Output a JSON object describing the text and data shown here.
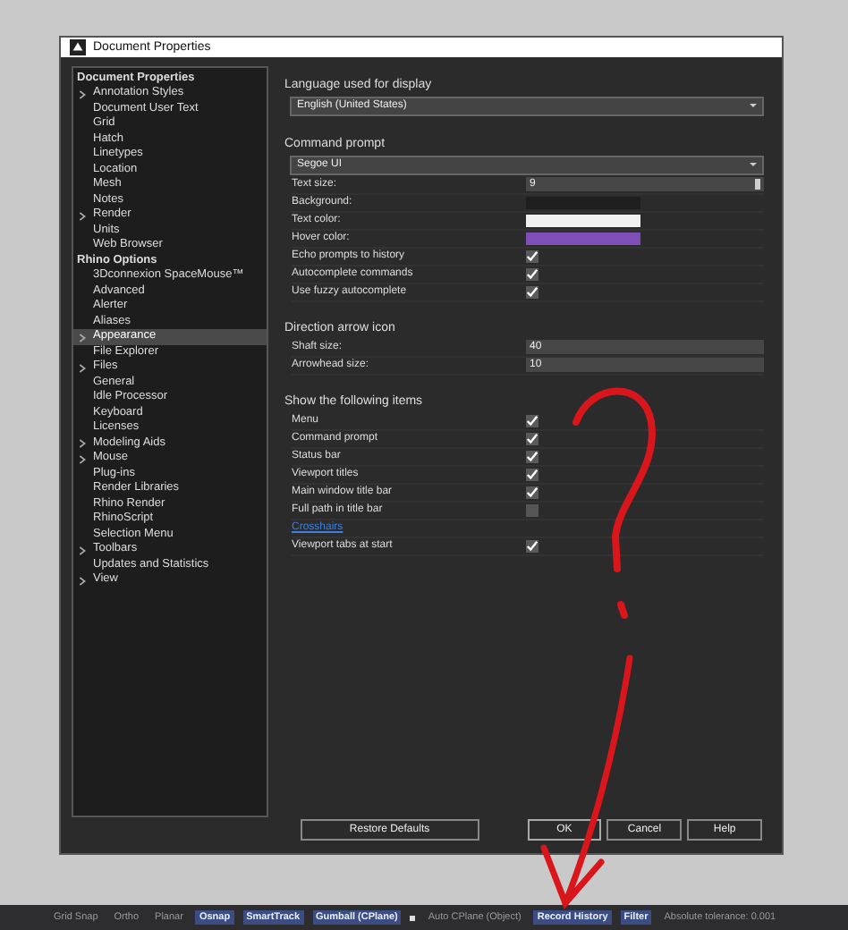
{
  "window": {
    "title": "Document Properties"
  },
  "tree": [
    {
      "label": "Document Properties",
      "selected": false,
      "children": [
        {
          "label": "Annotation Styles",
          "collapsible": true,
          "selected": false
        },
        {
          "label": "Document User Text",
          "collapsible": false,
          "selected": false
        },
        {
          "label": "Grid",
          "collapsible": false,
          "selected": false
        },
        {
          "label": "Hatch",
          "collapsible": false,
          "selected": false
        },
        {
          "label": "Linetypes",
          "collapsible": false,
          "selected": false
        },
        {
          "label": "Location",
          "collapsible": false,
          "selected": false
        },
        {
          "label": "Mesh",
          "collapsible": false,
          "selected": false
        },
        {
          "label": "Notes",
          "collapsible": false,
          "selected": false
        },
        {
          "label": "Render",
          "collapsible": true,
          "selected": false
        },
        {
          "label": "Units",
          "collapsible": false,
          "selected": false
        },
        {
          "label": "Web Browser",
          "collapsible": false,
          "selected": false
        }
      ]
    },
    {
      "label": "Rhino Options",
      "selected": false,
      "children": [
        {
          "label": "3Dconnexion SpaceMouse™",
          "collapsible": false,
          "selected": false
        },
        {
          "label": "Advanced",
          "collapsible": false,
          "selected": false
        },
        {
          "label": "Alerter",
          "collapsible": false,
          "selected": false
        },
        {
          "label": "Aliases",
          "collapsible": false,
          "selected": false
        },
        {
          "label": "Appearance",
          "collapsible": true,
          "selected": true
        },
        {
          "label": "File Explorer",
          "collapsible": false,
          "selected": false
        },
        {
          "label": "Files",
          "collapsible": true,
          "selected": false
        },
        {
          "label": "General",
          "collapsible": false,
          "selected": false
        },
        {
          "label": "Idle Processor",
          "collapsible": false,
          "selected": false
        },
        {
          "label": "Keyboard",
          "collapsible": false,
          "selected": false
        },
        {
          "label": "Licenses",
          "collapsible": false,
          "selected": false
        },
        {
          "label": "Modeling Aids",
          "collapsible": true,
          "selected": false
        },
        {
          "label": "Mouse",
          "collapsible": true,
          "selected": false
        },
        {
          "label": "Plug-ins",
          "collapsible": false,
          "selected": false
        },
        {
          "label": "Render Libraries",
          "collapsible": false,
          "selected": false
        },
        {
          "label": "Rhino Render",
          "collapsible": false,
          "selected": false
        },
        {
          "label": "RhinoScript",
          "collapsible": false,
          "selected": false
        },
        {
          "label": "Selection Menu",
          "collapsible": false,
          "selected": false
        },
        {
          "label": "Toolbars",
          "collapsible": true,
          "selected": false
        },
        {
          "label": "Updates and Statistics",
          "collapsible": false,
          "selected": false
        },
        {
          "label": "View",
          "collapsible": true,
          "selected": false
        }
      ]
    }
  ],
  "sections": [
    {
      "heading": "Language used for display",
      "rows": [
        {
          "kind": "dropdown",
          "value": "English (United States)"
        }
      ]
    },
    {
      "heading": "Command prompt",
      "rows": [
        {
          "kind": "dropdown",
          "value": "Segoe UI"
        },
        {
          "kind": "spin",
          "label": "Text size:",
          "value": "9"
        },
        {
          "kind": "color",
          "label": "Background:",
          "color": "#1e1e1e"
        },
        {
          "kind": "color",
          "label": "Text color:",
          "color": "#f0f0f0"
        },
        {
          "kind": "color",
          "label": "Hover color:",
          "color": "#7e4fb8"
        },
        {
          "kind": "check",
          "label": "Echo prompts to history",
          "checked": true
        },
        {
          "kind": "check",
          "label": "Autocomplete commands",
          "checked": true
        },
        {
          "kind": "check",
          "label": "Use fuzzy autocomplete",
          "checked": true
        }
      ]
    },
    {
      "heading": "Direction arrow icon",
      "rows": [
        {
          "kind": "number",
          "label": "Shaft size:",
          "value": "40"
        },
        {
          "kind": "number",
          "label": "Arrowhead size:",
          "value": "10"
        }
      ]
    },
    {
      "heading": "Show the following items",
      "rows": [
        {
          "kind": "check",
          "label": "Menu",
          "checked": true
        },
        {
          "kind": "check",
          "label": "Command prompt",
          "checked": true
        },
        {
          "kind": "check",
          "label": "Status bar",
          "checked": true
        },
        {
          "kind": "check",
          "label": "Viewport titles",
          "checked": true
        },
        {
          "kind": "check",
          "label": "Main window title bar",
          "checked": true
        },
        {
          "kind": "check",
          "label": "Full path in title bar",
          "checked": false
        },
        {
          "kind": "link",
          "label": "Crosshairs"
        },
        {
          "kind": "check",
          "label": "Viewport tabs at start",
          "checked": true
        }
      ]
    }
  ],
  "buttons": [
    {
      "label": "Restore Defaults",
      "kind": "wide"
    },
    {
      "label": "OK",
      "kind": "default"
    },
    {
      "label": "Cancel",
      "kind": "normal"
    },
    {
      "label": "Help",
      "kind": "normal"
    }
  ],
  "status_bar": [
    {
      "kind": "toggle",
      "label": "Grid Snap",
      "on": false
    },
    {
      "kind": "toggle",
      "label": "Ortho",
      "on": false
    },
    {
      "kind": "toggle",
      "label": "Planar",
      "on": false
    },
    {
      "kind": "toggle",
      "label": "Osnap",
      "on": true
    },
    {
      "kind": "toggle",
      "label": "SmartTrack",
      "on": true
    },
    {
      "kind": "toggle",
      "label": "Gumball (CPlane)",
      "on": true
    },
    {
      "kind": "checkbox",
      "label": "Auto CPlane (Object)",
      "checked": false
    },
    {
      "kind": "toggle",
      "label": "Record History",
      "on": true
    },
    {
      "kind": "toggle",
      "label": "Filter",
      "on": true
    },
    {
      "kind": "text",
      "label": "Absolute tolerance: 0.001"
    }
  ]
}
